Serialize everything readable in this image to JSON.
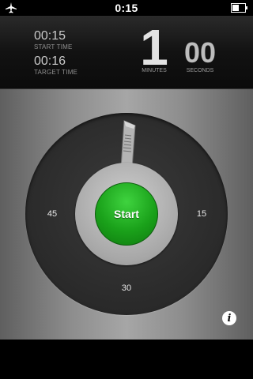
{
  "status_bar": {
    "time": "0:15",
    "left_icon": "airplane-icon",
    "right_icon": "battery-icon"
  },
  "timer": {
    "start_time": {
      "value": "00:15",
      "label": "START TIME"
    },
    "target_time": {
      "value": "00:16",
      "label": "TARGET TIME"
    },
    "minutes": {
      "value": "1",
      "label": "MINUTES"
    },
    "seconds": {
      "value": "00",
      "label": "SECONDS"
    }
  },
  "dial": {
    "labels": [
      "15",
      "30",
      "45"
    ],
    "pointer_icon": "dial-pointer-icon"
  },
  "start_button": {
    "label": "Start",
    "color": "#1aa11a"
  },
  "info_button": {
    "label": "i",
    "icon": "info-icon"
  }
}
